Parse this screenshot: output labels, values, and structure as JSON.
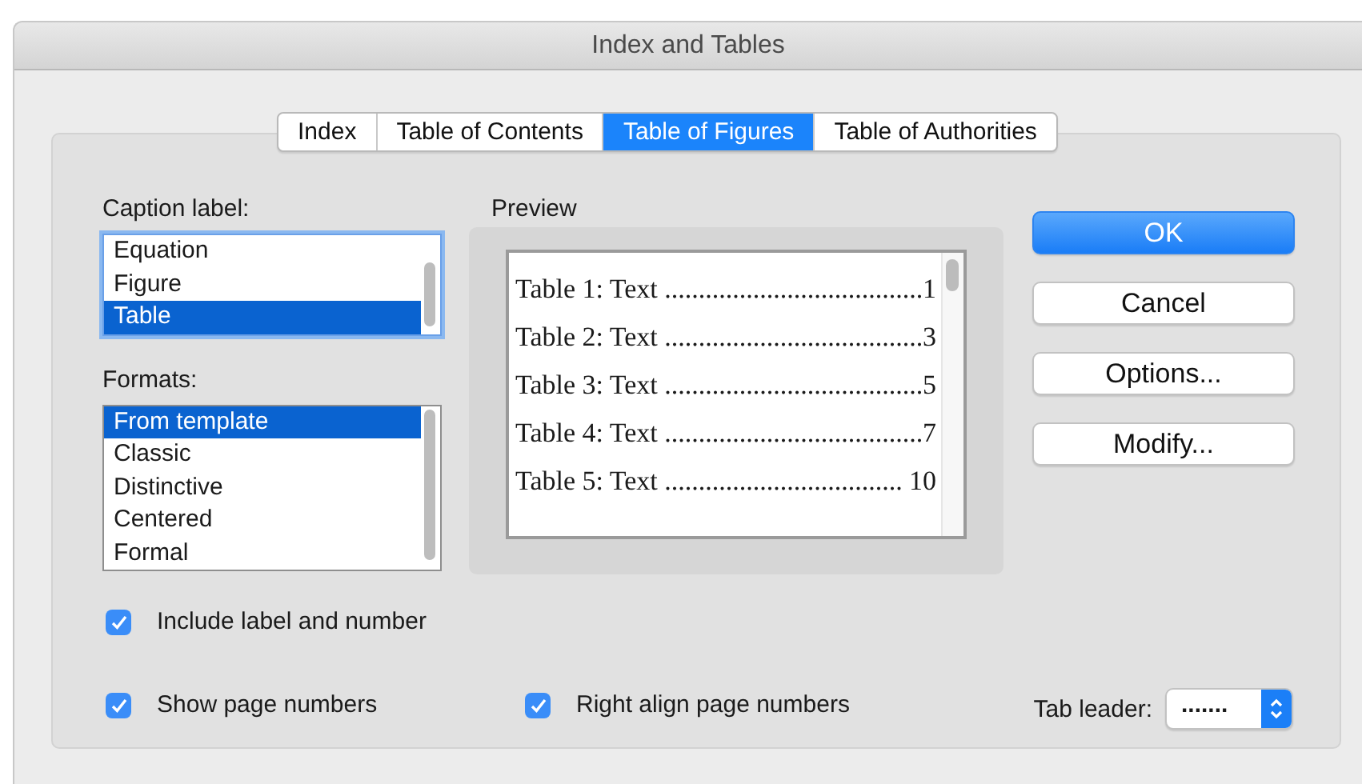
{
  "window": {
    "title": "Index and Tables"
  },
  "tabs": [
    {
      "label": "Index",
      "selected": false
    },
    {
      "label": "Table of Contents",
      "selected": false
    },
    {
      "label": "Table of Figures",
      "selected": true
    },
    {
      "label": "Table of Authorities",
      "selected": false
    }
  ],
  "caption_label": {
    "label": "Caption label:",
    "items": [
      {
        "label": "Equation",
        "selected": false
      },
      {
        "label": "Figure",
        "selected": false
      },
      {
        "label": "Table",
        "selected": true
      }
    ]
  },
  "formats": {
    "label": "Formats:",
    "items": [
      {
        "label": "From template",
        "selected": true
      },
      {
        "label": "Classic",
        "selected": false
      },
      {
        "label": "Distinctive",
        "selected": false
      },
      {
        "label": "Centered",
        "selected": false
      },
      {
        "label": "Formal",
        "selected": false
      }
    ]
  },
  "preview": {
    "label": "Preview",
    "entries": [
      {
        "caption": "Table 1: Text",
        "leader": "......................................",
        "page": "1"
      },
      {
        "caption": "Table 2: Text",
        "leader": "......................................",
        "page": "3"
      },
      {
        "caption": "Table 3: Text",
        "leader": "......................................",
        "page": "5"
      },
      {
        "caption": "Table 4: Text",
        "leader": "......................................",
        "page": "7"
      },
      {
        "caption": "Table 5: Text",
        "leader": "...................................",
        "page": "10"
      }
    ]
  },
  "buttons": [
    {
      "label": "OK",
      "kind": "default"
    },
    {
      "label": "Cancel",
      "kind": "plain"
    },
    {
      "label": "Options...",
      "kind": "plain"
    },
    {
      "label": "Modify...",
      "kind": "plain"
    }
  ],
  "checkboxes": [
    {
      "label": "Include label and number",
      "checked": true
    },
    {
      "label": "Show page numbers",
      "checked": true
    },
    {
      "label": "Right align page numbers",
      "checked": true
    }
  ],
  "tab_leader": {
    "label": "Tab leader:",
    "value": "......."
  }
}
